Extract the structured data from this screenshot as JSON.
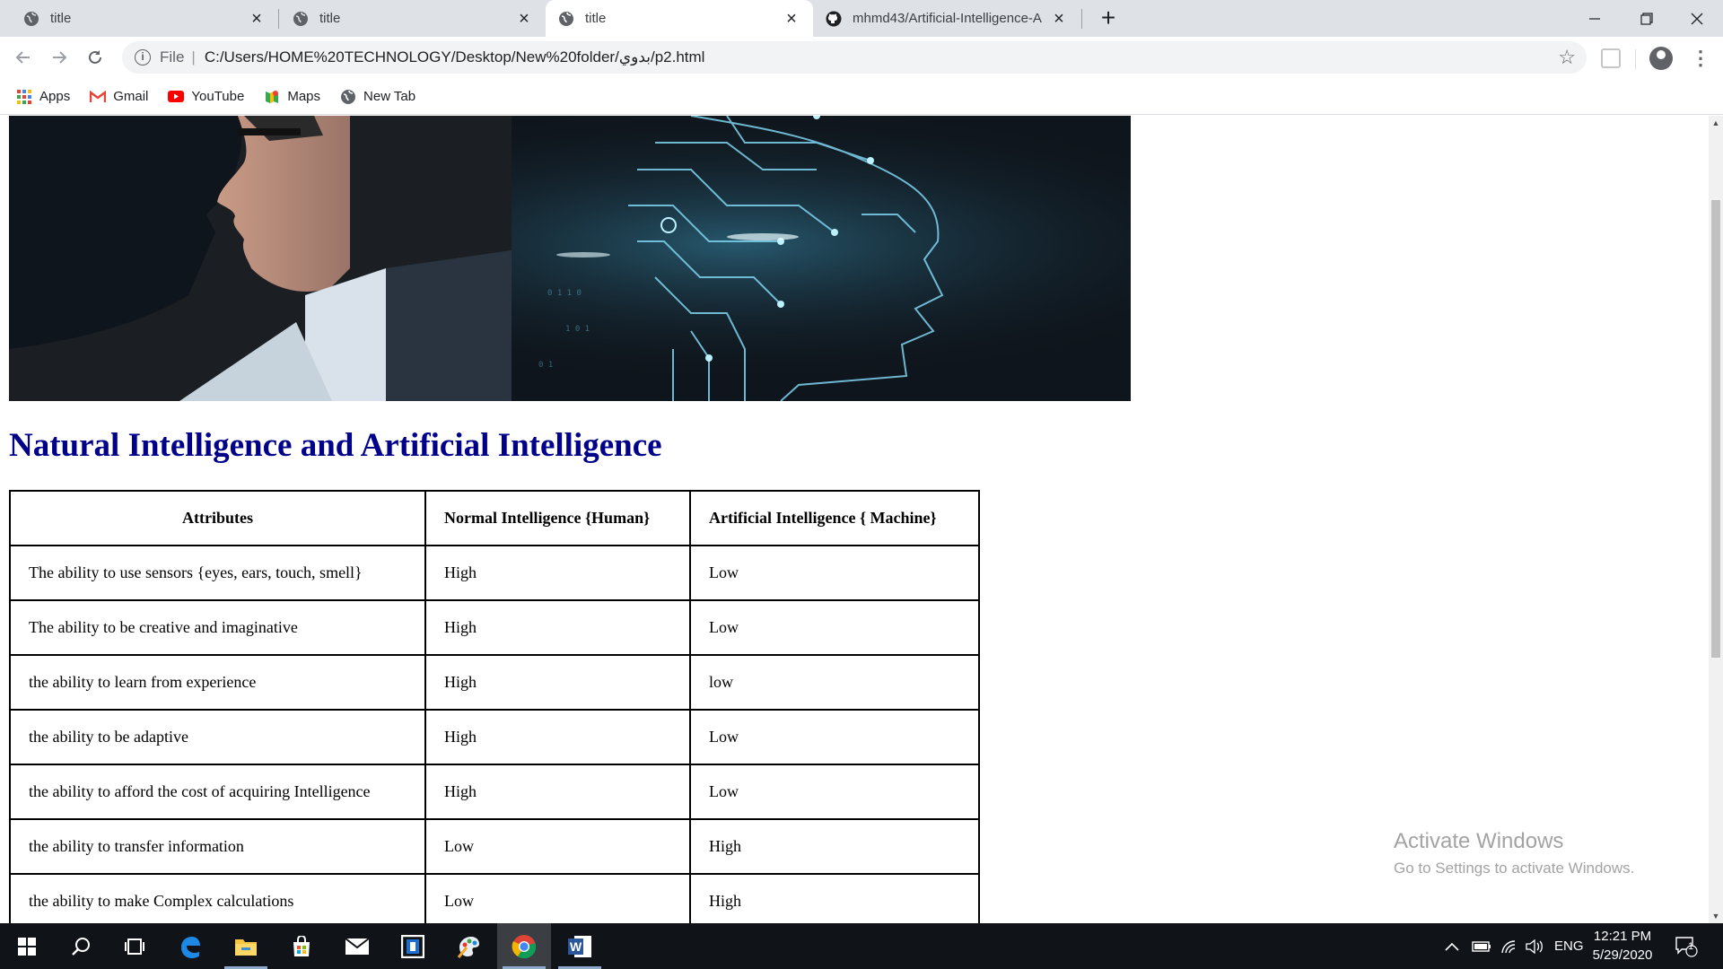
{
  "browser": {
    "tabs": [
      {
        "title": "title",
        "active": false
      },
      {
        "title": "title",
        "active": false
      },
      {
        "title": "title",
        "active": true
      },
      {
        "title": "mhmd43/Artificial-Intelligence-A",
        "active": false
      }
    ],
    "address": {
      "scheme_label": "File",
      "url": "C:/Users/HOME%20TECHNOLOGY/Desktop/New%20folder/بدوي/p2.html"
    },
    "bookmarks": [
      {
        "label": "Apps",
        "icon": "apps-grid-icon"
      },
      {
        "label": "Gmail",
        "icon": "gmail-icon"
      },
      {
        "label": "YouTube",
        "icon": "youtube-icon"
      },
      {
        "label": "Maps",
        "icon": "maps-icon"
      },
      {
        "label": "New Tab",
        "icon": "globe-icon"
      }
    ]
  },
  "page": {
    "title": "Natural Intelligence and Artificial Intelligence",
    "table": {
      "headers": [
        "Attributes",
        "Normal Intelligence {Human}",
        "Artificial Intelligence { Machine}"
      ],
      "rows": [
        [
          "The ability to use sensors {eyes, ears, touch, smell}",
          "High",
          "Low"
        ],
        [
          "The ability to be creative and imaginative",
          "High",
          "Low"
        ],
        [
          "the ability to learn from experience",
          "High",
          "low"
        ],
        [
          "the ability to be adaptive",
          "High",
          "Low"
        ],
        [
          "the ability to afford the cost of acquiring Intelligence",
          "High",
          "Low"
        ],
        [
          "the ability to transfer information",
          "Low",
          "High"
        ],
        [
          "the ability to make Complex calculations",
          "Low",
          "High"
        ]
      ]
    }
  },
  "watermark": {
    "line1": "Activate Windows",
    "line2": "Go to Settings to activate Windows."
  },
  "taskbar": {
    "apps": [
      "start-icon",
      "search-icon",
      "task-view-icon",
      "edge-icon",
      "file-explorer-icon",
      "store-icon",
      "mail-icon",
      "app-icon",
      "paint-icon",
      "chrome-icon",
      "word-icon"
    ],
    "language": "ENG",
    "time": "12:21 PM",
    "date": "5/29/2020",
    "notification_count": "1"
  },
  "colors": {
    "title_color": "#00008b",
    "tabstrip_bg": "#dee1e6",
    "taskbar_bg": "#101418"
  }
}
